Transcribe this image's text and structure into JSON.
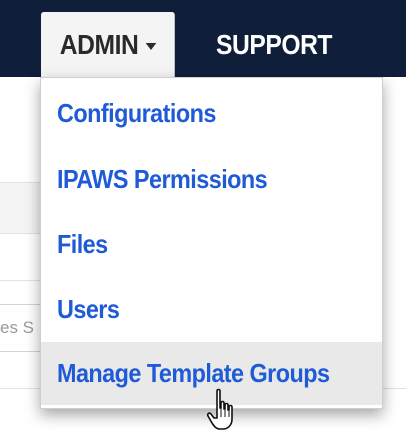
{
  "navbar": {
    "admin_label": "ADMIN",
    "support_label": "SUPPORT",
    "background_color": "#0f1f3a"
  },
  "background_page": {
    "partial_text": "es S"
  },
  "dropdown": {
    "items": [
      {
        "label": "Configurations"
      },
      {
        "label": "IPAWS Permissions"
      },
      {
        "label": "Files"
      },
      {
        "label": "Users"
      },
      {
        "label": "Manage Template Groups",
        "hovered": true
      }
    ],
    "link_color": "#1f5bd6",
    "hover_background": "#e9e9e9"
  },
  "cursor": {
    "icon": "hand-pointer-icon"
  }
}
